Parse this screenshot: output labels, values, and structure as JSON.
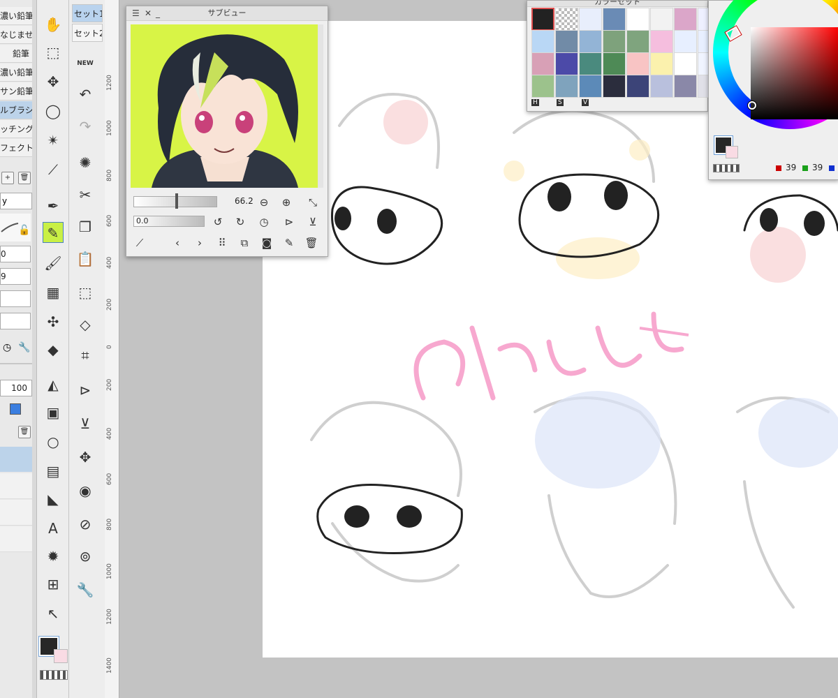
{
  "subtool_panel": {
    "items": [
      {
        "label": "濃い鉛筆"
      },
      {
        "label": "なじませ"
      },
      {
        "label": "鉛筆"
      },
      {
        "label": "濃い鉛筆"
      },
      {
        "label": "サン鉛筆"
      },
      {
        "label": "ルブラシ"
      },
      {
        "label": "ッチング"
      },
      {
        "label": "フェクト"
      }
    ],
    "dropdown_label": "y",
    "spin_value_1": "0",
    "spin_value_2": "9",
    "opacity_value": "100"
  },
  "command_bar": {
    "set_tabs": [
      {
        "label": "セット1"
      },
      {
        "label": "セット2"
      }
    ]
  },
  "ruler": {
    "labels": [
      "1200",
      "1000",
      "800",
      "600",
      "400",
      "200",
      "0",
      "200",
      "400",
      "600",
      "800",
      "1000",
      "1200",
      "1400"
    ]
  },
  "subview": {
    "title": "サブビュー",
    "zoom_value": "66.2",
    "rotation_value": "0.0"
  },
  "color_set": {
    "title": "カラーセット",
    "swatches": [
      "#222222",
      "checker",
      "#e8eefc",
      "#6a8bb5",
      "#ffffff",
      "#f2f2f2",
      "#dba6c9",
      "#eef0ff",
      "#b9d7f5",
      "#718ba7",
      "#93b4d6",
      "#7ea27c",
      "#7fa47e",
      "#f5bede",
      "#e7efff",
      "#e8efff",
      "#d8a0b6",
      "#4c4aa8",
      "#4a8a7e",
      "#4e8a56",
      "#f8c4c4",
      "#fbf1ad",
      "#ffffff",
      "#f0f4ff",
      "#9cc28c",
      "#7fa3bd",
      "#5c8ab8",
      "#2b2d3d",
      "#3c4478",
      "#b9c0dd",
      "#8a88a8",
      "#e0e0e8"
    ],
    "bottom_labels": [
      "H",
      "S",
      "V"
    ]
  },
  "color_wheel": {
    "rgb_r": "39",
    "rgb_g": "39",
    "main_color": "#272727",
    "sub_color": "#f9dbe4"
  },
  "tool_current_color": "#272727"
}
